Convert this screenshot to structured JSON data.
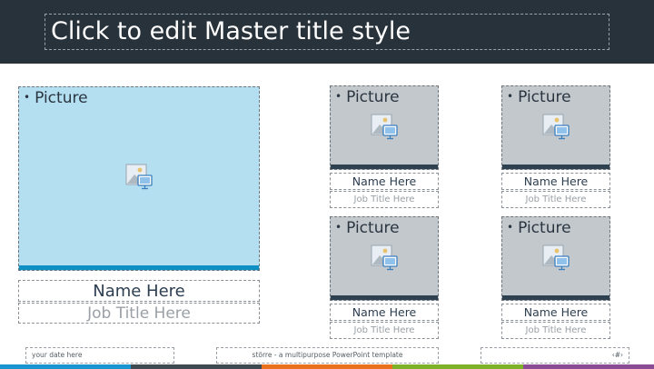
{
  "master_title": "Click to edit Master title style",
  "placeholder_bullet": "•",
  "large_card": {
    "picture_label": "Picture",
    "name": "Name Here",
    "job_title": "Job Title Here"
  },
  "small_cards": [
    {
      "picture_label": "Picture",
      "name": "Name Here",
      "job_title": "Job Title Here"
    },
    {
      "picture_label": "Picture",
      "name": "Name Here",
      "job_title": "Job Title Here"
    },
    {
      "picture_label": "Picture",
      "name": "Name Here",
      "job_title": "Job Title Here"
    },
    {
      "picture_label": "Picture",
      "name": "Name Here",
      "job_title": "Job Title Here"
    }
  ],
  "footer": {
    "date": "your date here",
    "center": "större - a multipurpose PowerPoint template",
    "page": "‹#›"
  },
  "colors": {
    "header_bg": "#28323a",
    "large_picture_fill": "#b3dff0",
    "large_picture_bar": "#0e90c4",
    "small_picture_fill": "#c3c8cd",
    "small_picture_bar": "#2d4151",
    "stripes": [
      "#1a95d2",
      "#3e4a52",
      "#e9711d",
      "#7cb128",
      "#8b4c96"
    ]
  },
  "icons": [
    "picture-placeholder-icon"
  ]
}
